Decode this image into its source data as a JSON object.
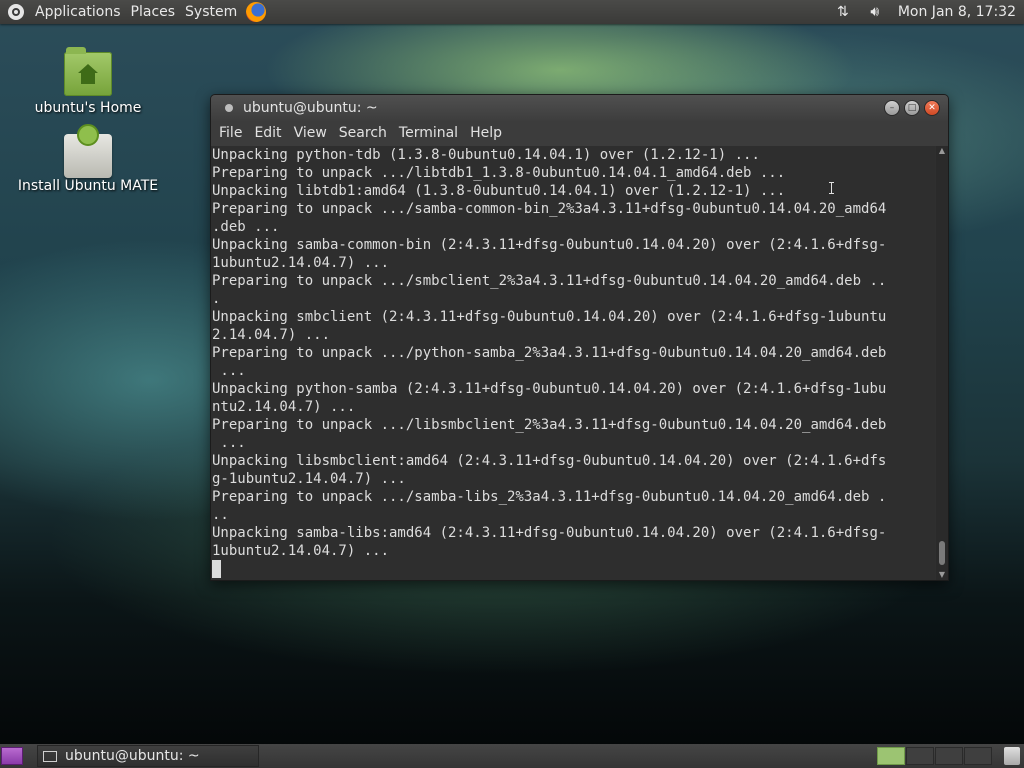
{
  "top_panel": {
    "menus": [
      "Applications",
      "Places",
      "System"
    ],
    "clock": "Mon Jan 8, 17:32",
    "network_icon": "network-arrows-icon",
    "volume_icon": "volume-icon"
  },
  "desktop": {
    "icons": [
      {
        "label": "ubuntu's Home",
        "icon": "home-folder-icon"
      },
      {
        "label": "Install Ubuntu MATE",
        "icon": "installer-icon"
      }
    ]
  },
  "terminal": {
    "title": "ubuntu@ubuntu: ~",
    "menu": [
      "File",
      "Edit",
      "View",
      "Search",
      "Terminal",
      "Help"
    ],
    "lines": [
      "Unpacking python-tdb (1.3.8-0ubuntu0.14.04.1) over (1.2.12-1) ...",
      "Preparing to unpack .../libtdb1_1.3.8-0ubuntu0.14.04.1_amd64.deb ...",
      "Unpacking libtdb1:amd64 (1.3.8-0ubuntu0.14.04.1) over (1.2.12-1) ...",
      "Preparing to unpack .../samba-common-bin_2%3a4.3.11+dfsg-0ubuntu0.14.04.20_amd64",
      ".deb ...",
      "Unpacking samba-common-bin (2:4.3.11+dfsg-0ubuntu0.14.04.20) over (2:4.1.6+dfsg-",
      "1ubuntu2.14.04.7) ...",
      "Preparing to unpack .../smbclient_2%3a4.3.11+dfsg-0ubuntu0.14.04.20_amd64.deb ..",
      ".",
      "Unpacking smbclient (2:4.3.11+dfsg-0ubuntu0.14.04.20) over (2:4.1.6+dfsg-1ubuntu",
      "2.14.04.7) ...",
      "Preparing to unpack .../python-samba_2%3a4.3.11+dfsg-0ubuntu0.14.04.20_amd64.deb",
      " ...",
      "Unpacking python-samba (2:4.3.11+dfsg-0ubuntu0.14.04.20) over (2:4.1.6+dfsg-1ubu",
      "ntu2.14.04.7) ...",
      "Preparing to unpack .../libsmbclient_2%3a4.3.11+dfsg-0ubuntu0.14.04.20_amd64.deb",
      " ...",
      "Unpacking libsmbclient:amd64 (2:4.3.11+dfsg-0ubuntu0.14.04.20) over (2:4.1.6+dfs",
      "g-1ubuntu2.14.04.7) ...",
      "Preparing to unpack .../samba-libs_2%3a4.3.11+dfsg-0ubuntu0.14.04.20_amd64.deb .",
      "..",
      "Unpacking samba-libs:amd64 (2:4.3.11+dfsg-0ubuntu0.14.04.20) over (2:4.1.6+dfsg-",
      "1ubuntu2.14.04.7) ..."
    ]
  },
  "bottom_panel": {
    "task_label": "ubuntu@ubuntu: ~",
    "workspaces": 4,
    "active_workspace": 1
  },
  "colors": {
    "accent_green": "#9cc472",
    "terminal_bg": "#2e2e2e",
    "close_button": "#d04a25"
  }
}
